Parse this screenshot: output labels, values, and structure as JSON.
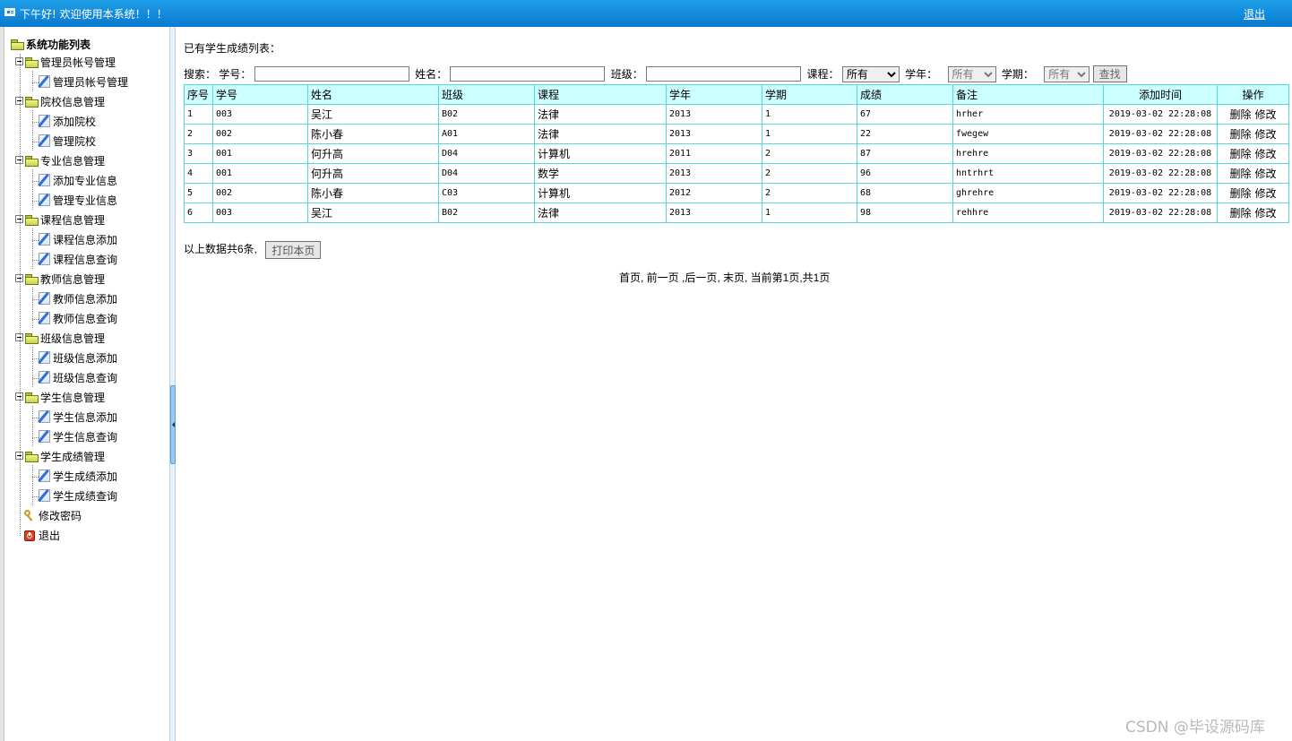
{
  "topbar": {
    "greeting": "下午好! 欢迎使用本系统！！！",
    "logout": "退出"
  },
  "sidebar": {
    "root": "系统功能列表",
    "groups": [
      {
        "label": "管理员帐号管理",
        "items": [
          "管理员帐号管理"
        ]
      },
      {
        "label": "院校信息管理",
        "items": [
          "添加院校",
          "管理院校"
        ]
      },
      {
        "label": "专业信息管理",
        "items": [
          "添加专业信息",
          "管理专业信息"
        ]
      },
      {
        "label": "课程信息管理",
        "items": [
          "课程信息添加",
          "课程信息查询"
        ]
      },
      {
        "label": "教师信息管理",
        "items": [
          "教师信息添加",
          "教师信息查询"
        ]
      },
      {
        "label": "班级信息管理",
        "items": [
          "班级信息添加",
          "班级信息查询"
        ]
      },
      {
        "label": "学生信息管理",
        "items": [
          "学生信息添加",
          "学生信息查询"
        ]
      },
      {
        "label": "学生成绩管理",
        "items": [
          "学生成绩添加",
          "学生成绩查询"
        ]
      }
    ],
    "change_password": "修改密码",
    "exit": "退出"
  },
  "main": {
    "caption": "已有学生成绩列表：",
    "search": {
      "label": "搜索：",
      "student_no_label": "学号：",
      "name_label": "姓名：",
      "class_label": "班级：",
      "course_label": "课程：",
      "course_value": "所有",
      "year_label": "学年：",
      "year_value": "所有",
      "term_label": "学期：",
      "term_value": "所有",
      "find_button": "查找"
    },
    "table": {
      "headers": [
        "序号",
        "学号",
        "姓名",
        "班级",
        "课程",
        "学年",
        "学期",
        "成绩",
        "备注",
        "添加时间",
        "操作"
      ],
      "delete_label": "删除",
      "edit_label": "修改",
      "rows": [
        [
          "1",
          "003",
          "吴江",
          "B02",
          "法律",
          "2013",
          "1",
          "67",
          "hrher",
          "2019-03-02 22:28:08"
        ],
        [
          "2",
          "002",
          "陈小春",
          "A01",
          "法律",
          "2013",
          "1",
          "22",
          "fwegew",
          "2019-03-02 22:28:08"
        ],
        [
          "3",
          "001",
          "何升高",
          "D04",
          "计算机",
          "2011",
          "2",
          "87",
          "hrehre",
          "2019-03-02 22:28:08"
        ],
        [
          "4",
          "001",
          "何升高",
          "D04",
          "数学",
          "2013",
          "2",
          "96",
          "hntrhrt",
          "2019-03-02 22:28:08"
        ],
        [
          "5",
          "002",
          "陈小春",
          "C03",
          "计算机",
          "2012",
          "2",
          "68",
          "ghrehre",
          "2019-03-02 22:28:08"
        ],
        [
          "6",
          "003",
          "吴江",
          "B02",
          "法律",
          "2013",
          "1",
          "98",
          "rehhre",
          "2019-03-02 22:28:08"
        ]
      ]
    },
    "summary": "以上数据共6条,",
    "print_button": "打印本页",
    "pager": "首页, 前一页 ,后一页, 末页, 当前第1页,共1页"
  },
  "watermark": "CSDN @毕设源码库"
}
